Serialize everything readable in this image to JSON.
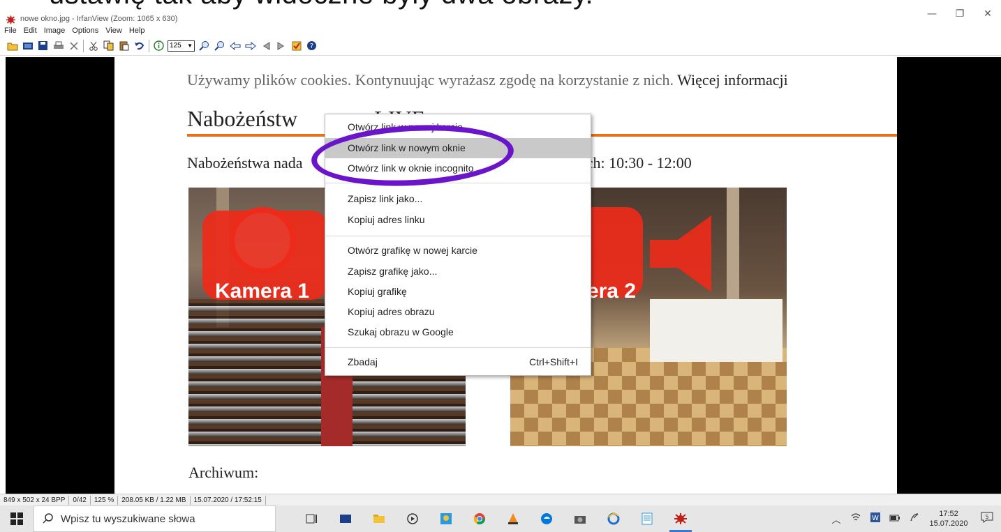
{
  "overlay_text": "ustawię tak aby widoczne były dwa obrazy.",
  "window": {
    "title": "nowe okno.jpg - IrfanView (Zoom: 1065 x 630)",
    "minimize": "—",
    "restore": "❐",
    "close": "✕"
  },
  "menu": {
    "items": [
      "File",
      "Edit",
      "Image",
      "Options",
      "View",
      "Help"
    ]
  },
  "toolbar": {
    "zoom_value": "125",
    "icons": [
      "open-icon",
      "slideshow-icon",
      "save-icon",
      "print-icon",
      "delete-icon",
      "cut-icon",
      "copy-icon",
      "paste-icon",
      "undo-icon",
      "info-icon",
      "zoom-in-icon",
      "zoom-out-icon",
      "previous-icon",
      "next-icon",
      "first-icon",
      "last-icon",
      "options-icon",
      "help-icon"
    ]
  },
  "page": {
    "cookie_text": "Używamy plików cookies. Kontynuując wyrażasz zgodę na korzystanie z nich.",
    "cookie_link": "Więcej informacji",
    "heading": "Nabożeństw",
    "heading_tail": "LIVE",
    "schedule_left": "Nabożeństwa nada",
    "schedule_right": "ach: 10:30 - 12:00",
    "camera1_label": "Kamera 1",
    "camera2_label": "era 2",
    "archive": "Archiwum:"
  },
  "context_menu": {
    "items": [
      {
        "label": "Otwórz link w nowej karcie",
        "highlighted": false
      },
      {
        "label": "Otwórz link w nowym oknie",
        "highlighted": true
      },
      {
        "label": "Otwórz link w oknie incognito",
        "highlighted": false
      },
      {
        "label": "Zapisz link jako...",
        "highlighted": false
      },
      {
        "label": "Kopiuj adres linku",
        "highlighted": false
      },
      {
        "label": "Otwórz grafikę w nowej karcie",
        "highlighted": false
      },
      {
        "label": "Zapisz grafikę jako...",
        "highlighted": false
      },
      {
        "label": "Kopiuj grafikę",
        "highlighted": false
      },
      {
        "label": "Kopiuj adres obrazu",
        "highlighted": false
      },
      {
        "label": "Szukaj obrazu w Google",
        "highlighted": false
      },
      {
        "label": "Zbadaj",
        "highlighted": false,
        "shortcut": "Ctrl+Shift+I"
      }
    ]
  },
  "annotation_color": "#6a15c9",
  "statusbar": {
    "dimensions": "849 x 502 x 24 BPP",
    "index": "0/42",
    "zoom": "125 %",
    "size": "208.05 KB / 1.22 MB",
    "datetime": "15.07.2020 / 17:52:15"
  },
  "taskbar": {
    "search_placeholder": "Wpisz tu wyszukiwane słowa",
    "clock_time": "17:52",
    "clock_date": "15.07.2020",
    "notification_count": "5"
  },
  "colors": {
    "accent_orange": "#e8701a",
    "camera_red": "#ee2a1a",
    "taskbar_active": "#3a78d4"
  }
}
